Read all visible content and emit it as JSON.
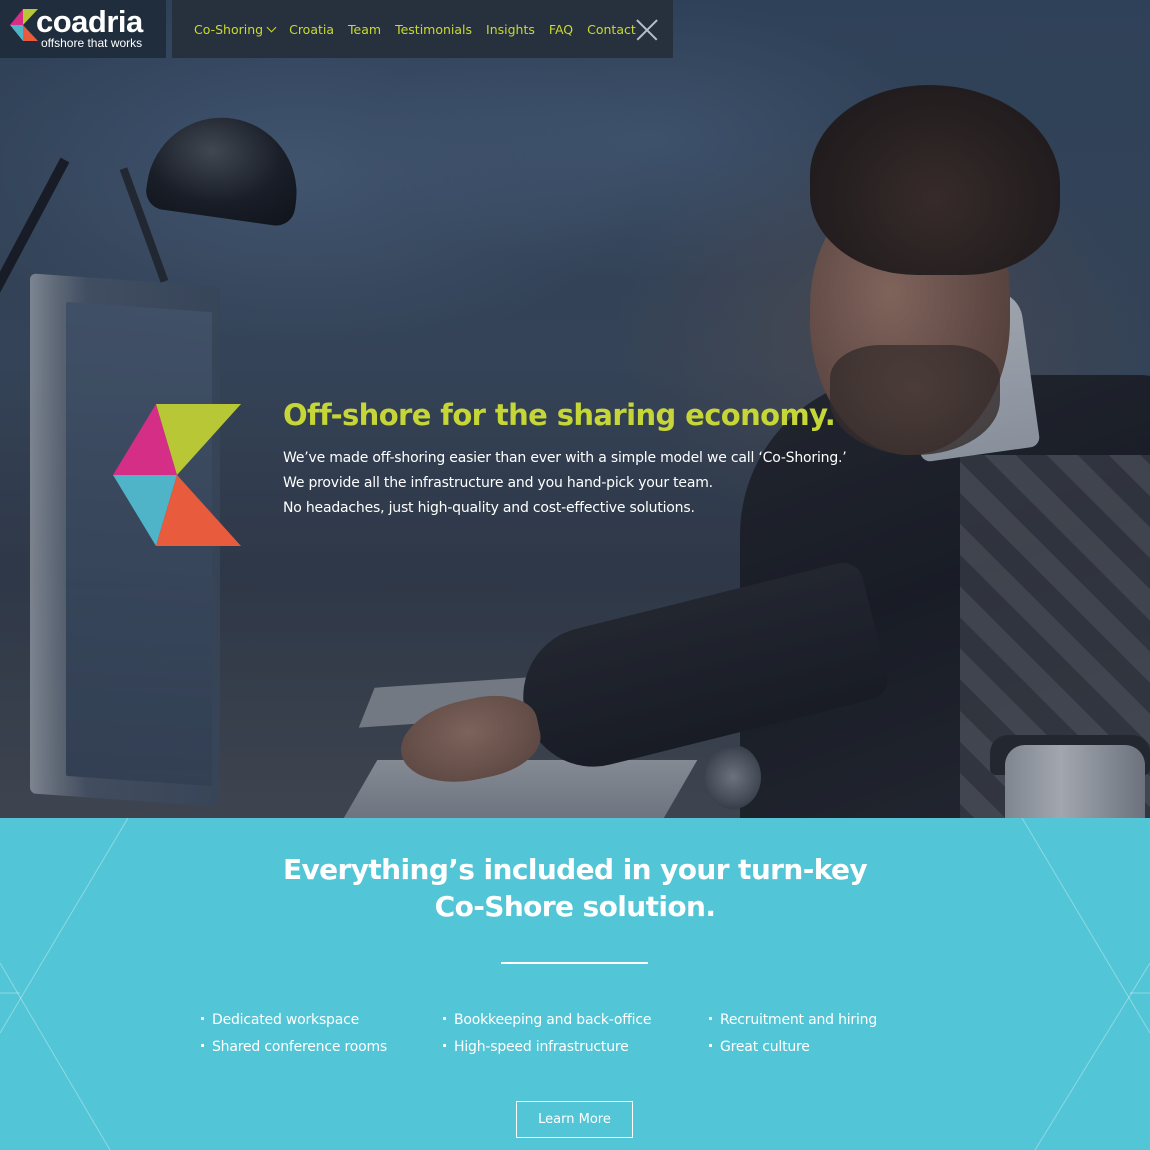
{
  "brand": {
    "name": "coadria",
    "tagline": "offshore that works",
    "colors": {
      "magenta": "#d52e86",
      "lime": "#b7c735",
      "cyan": "#50b4c9",
      "orange": "#e85b3c",
      "navy": "#1f2d3d",
      "nav_text": "#c8d92f",
      "section_bg": "#52c5d6"
    }
  },
  "nav": {
    "items": [
      {
        "label": "Co-Shoring",
        "has_dropdown": true
      },
      {
        "label": "Croatia"
      },
      {
        "label": "Team"
      },
      {
        "label": "Testimonials"
      },
      {
        "label": "Insights"
      },
      {
        "label": "FAQ"
      },
      {
        "label": "Contact"
      }
    ],
    "close_icon": "close-icon"
  },
  "hero": {
    "title": "Off-shore for the sharing economy.",
    "lines": [
      "We’ve made off-shoring easier than ever with a simple model we call ‘Co-Shoring.’",
      "We provide all the infrastructure and you hand-pick your team.",
      "No headaches, just high-quality and cost-effective solutions."
    ]
  },
  "features": {
    "title_line1": "Everything’s included in your turn-key",
    "title_line2": "Co-Shore solution.",
    "columns": [
      [
        "Dedicated workspace",
        "Shared conference rooms"
      ],
      [
        "Bookkeeping and back-office",
        "High-speed infrastructure"
      ],
      [
        "Recruitment and hiring",
        "Great culture"
      ]
    ],
    "cta_label": "Learn More"
  }
}
